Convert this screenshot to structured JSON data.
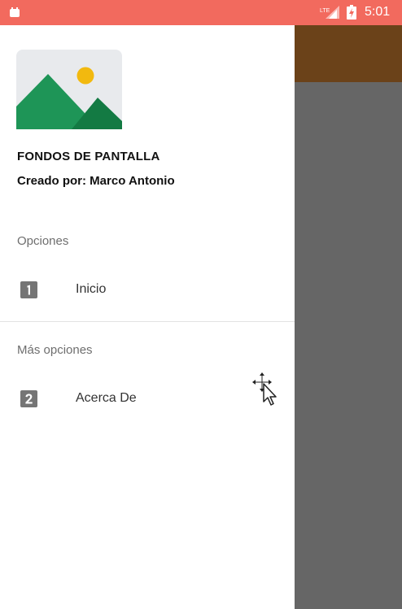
{
  "status_bar": {
    "time": "5:01",
    "color": "#f26a5e",
    "icons": [
      "notification-icon",
      "signal-icon",
      "battery-icon"
    ]
  },
  "app_bar": {
    "color": "#6b4219"
  },
  "drawer": {
    "header": {
      "image_icon": "image-placeholder-icon",
      "title": "FONDOS DE PANTALLA",
      "subtitle": "Creado por: Marco Antonio"
    },
    "sections": [
      {
        "header": "Opciones",
        "items": [
          {
            "icon": "number-1-icon",
            "label": "Inicio"
          }
        ]
      },
      {
        "header": "Más opciones",
        "items": [
          {
            "icon": "number-2-icon",
            "label": "Acerca De"
          }
        ]
      }
    ]
  },
  "colors": {
    "scrim": "#666666",
    "drawer_background": "#ffffff",
    "icon_grey": "#757575"
  }
}
